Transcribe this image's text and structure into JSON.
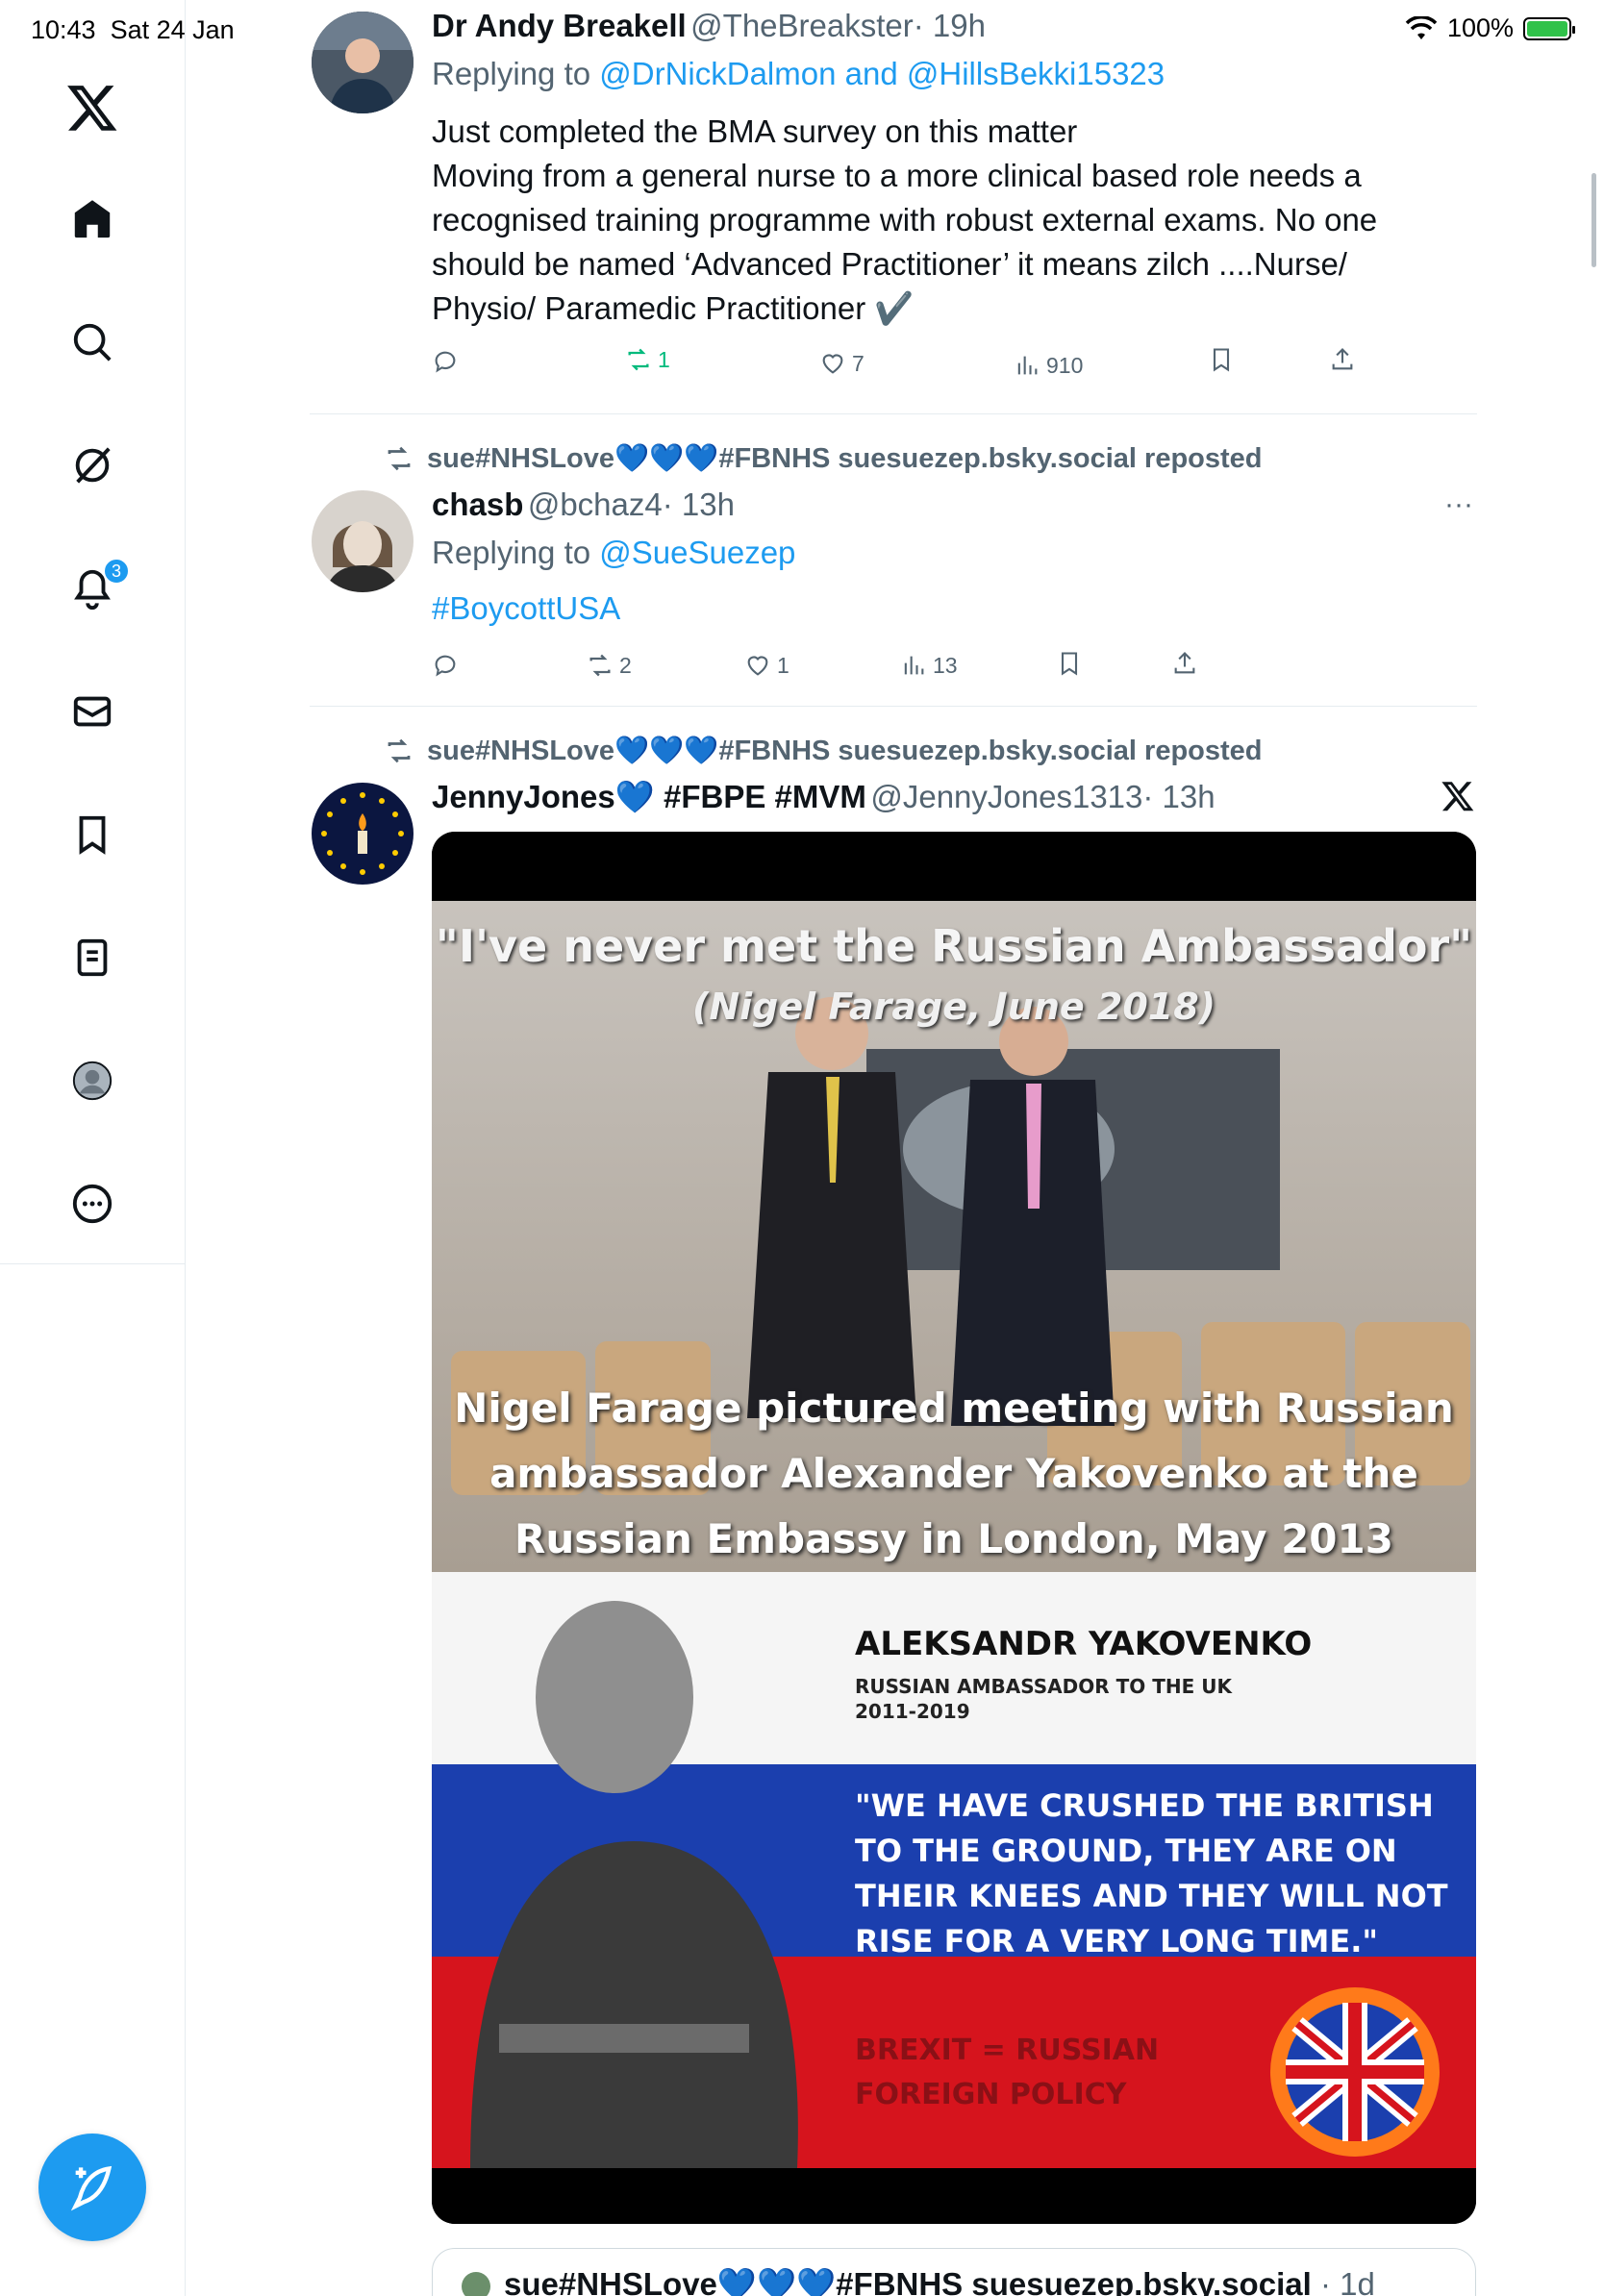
{
  "status_bar": {
    "time": "10:43",
    "date": "Sat 24 Jan",
    "battery": "100%"
  },
  "sidebar": {
    "notifications_badge": "3",
    "items": [
      "home",
      "search",
      "grok",
      "notifications",
      "messages",
      "bookmarks",
      "lists",
      "profile",
      "more"
    ]
  },
  "tweet1": {
    "name": "Dr Andy Breakell",
    "handle": "@TheBreakster",
    "time": "· 19h",
    "replying_prefix": "Replying to ",
    "replying_to": "@DrNickDalmon and @HillsBekki15323",
    "lines": [
      "Just completed the BMA survey on this matter",
      "Moving from a general nurse to a more clinical based role needs a",
      "recognised training programme with robust external exams. No one",
      "should be named ‘Advanced Practitioner’ it means zilch ....Nurse/",
      "Physio/ Paramedic  Practitioner ✔️"
    ],
    "reposts": "1",
    "likes": "7",
    "views": "910"
  },
  "tweet2": {
    "repost_by": "sue#NHSLove💙💙💙#FBNHS suesuezep.bsky.social reposted",
    "name": "chasb",
    "handle": "@bchaz4",
    "time": "· 13h",
    "replying_prefix": "Replying to ",
    "replying_to": "@SueSuezep",
    "text": "#BoycottUSA",
    "reposts": "2",
    "likes": "1",
    "views": "13"
  },
  "tweet3": {
    "repost_by": "sue#NHSLove💙💙💙#FBNHS suesuezep.bsky.social reposted",
    "name": "JennyJones💙 #FBPE #MVM",
    "handle": "@JennyJones1313",
    "time": "· 13h",
    "image": {
      "headline": "\"I've never met the Russian Ambassador\"",
      "attribution": "(Nigel Farage, June 2018)",
      "caption_lines": [
        "Nigel Farage pictured meeting with Russian",
        "ambassador Alexander Yakovenko at the",
        "Russian Embassy in London, May 2013"
      ],
      "person_name": "ALEKSANDR YAKOVENKO",
      "person_title": "RUSSIAN AMBASSADOR TO THE UK",
      "person_years": "2011-2019",
      "quote_lines": [
        "\"WE HAVE CRUSHED THE BRITISH",
        "TO THE GROUND, THEY ARE ON",
        "THEIR KNEES AND THEY WILL NOT",
        "RISE FOR A VERY LONG TIME.\""
      ],
      "footer_lines": [
        "BREXIT = RUSSIAN",
        "FOREIGN POLICY"
      ]
    }
  },
  "quote_card": {
    "name": "sue#NHSLove💙💙💙#FBNHS suesuezep.bsky.social",
    "time": "· 1d"
  },
  "colors": {
    "accent": "#1d9bf0",
    "repost_green": "#00ba7c",
    "secondary_text": "#536471"
  }
}
